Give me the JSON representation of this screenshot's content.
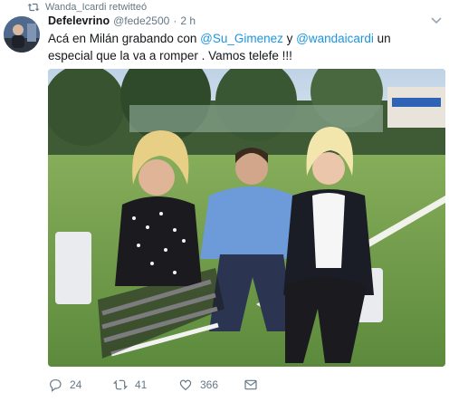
{
  "retweet_bar": {
    "text": "Wanda_Icardi retwitteó",
    "icon": "retweet-icon"
  },
  "tweet": {
    "display_name": "Defelevrino",
    "handle": "@fede2500",
    "separator": "·",
    "time": "2 h",
    "text_parts": {
      "p1": "Acá en Milán grabando con ",
      "mention1": "@Su_Gimenez",
      "p2": " y ",
      "mention2": "@wandaicardi",
      "p3": " un especial que la va a romper . Vamos telefe !!!"
    },
    "media": {
      "alt": "photo"
    }
  },
  "actions": {
    "replies": "24",
    "retweets": "41",
    "likes": "366"
  },
  "colors": {
    "link": "#1b95e0",
    "secondary_text": "#657786",
    "primary_text": "#14171a"
  }
}
